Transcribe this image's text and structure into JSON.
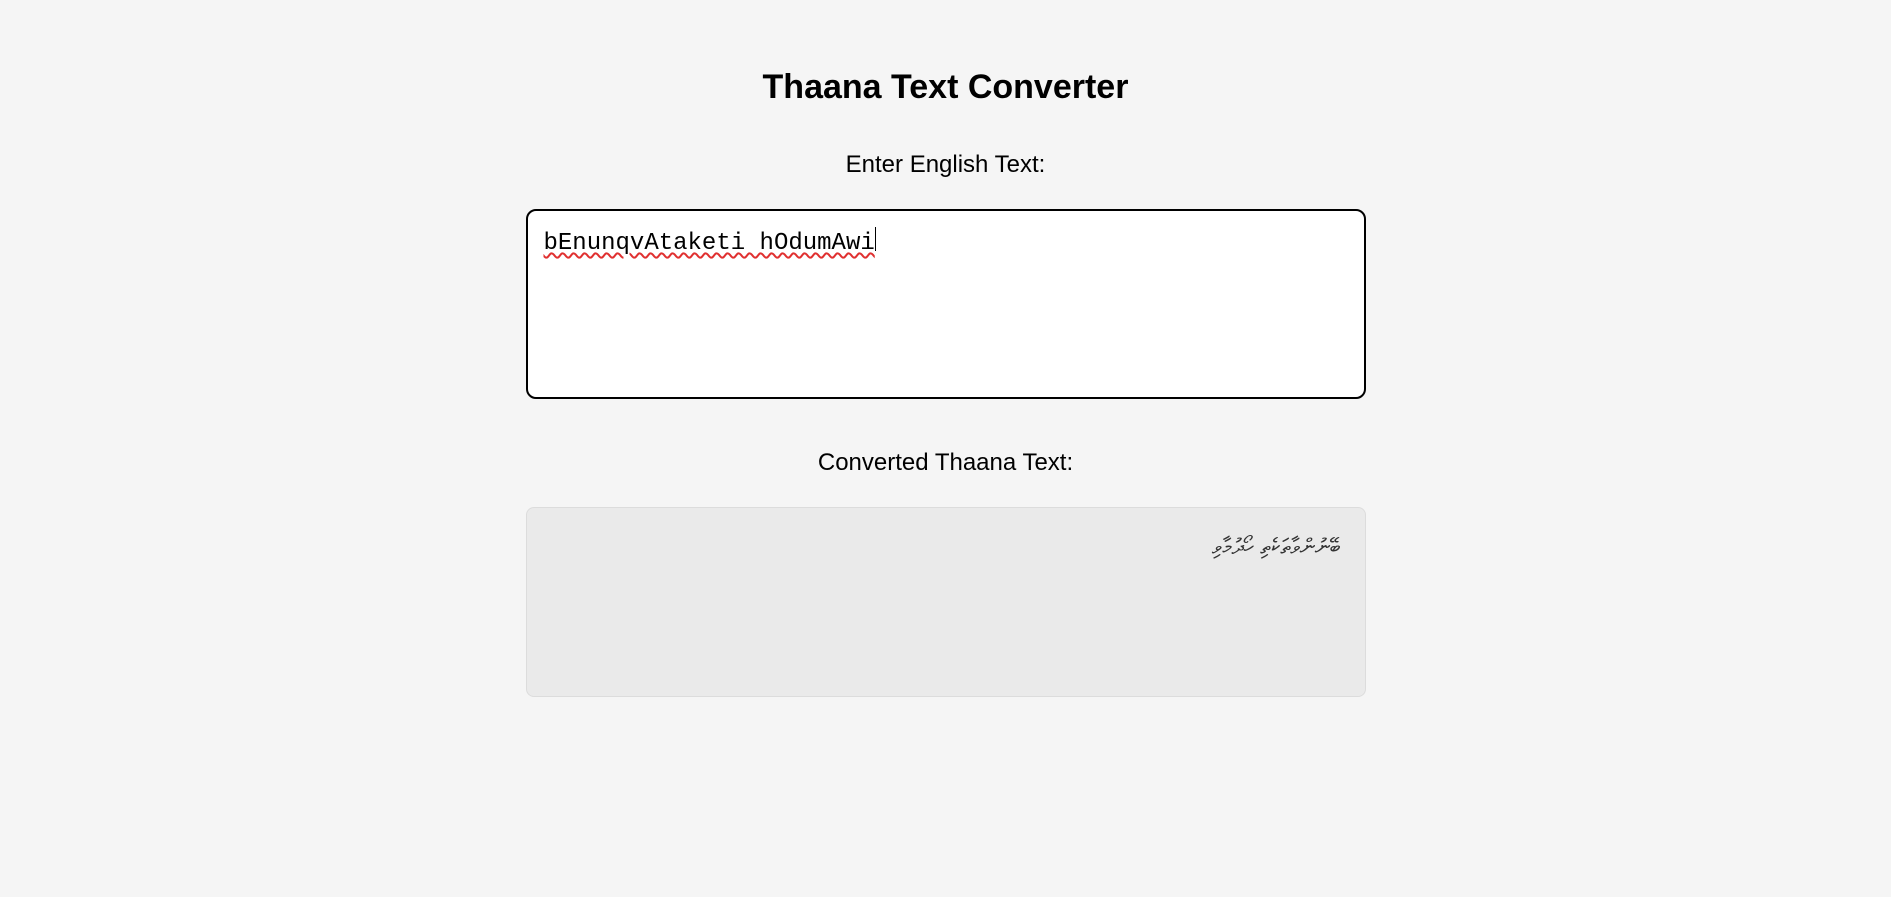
{
  "title": "Thaana Text Converter",
  "input": {
    "label": "Enter English Text:",
    "value": "bEnunqvAtaketi hOdumAwi"
  },
  "output": {
    "label": "Converted Thaana Text:",
    "value": "ބޭނުންވާތަކެތި ހޯދުމާވި"
  }
}
